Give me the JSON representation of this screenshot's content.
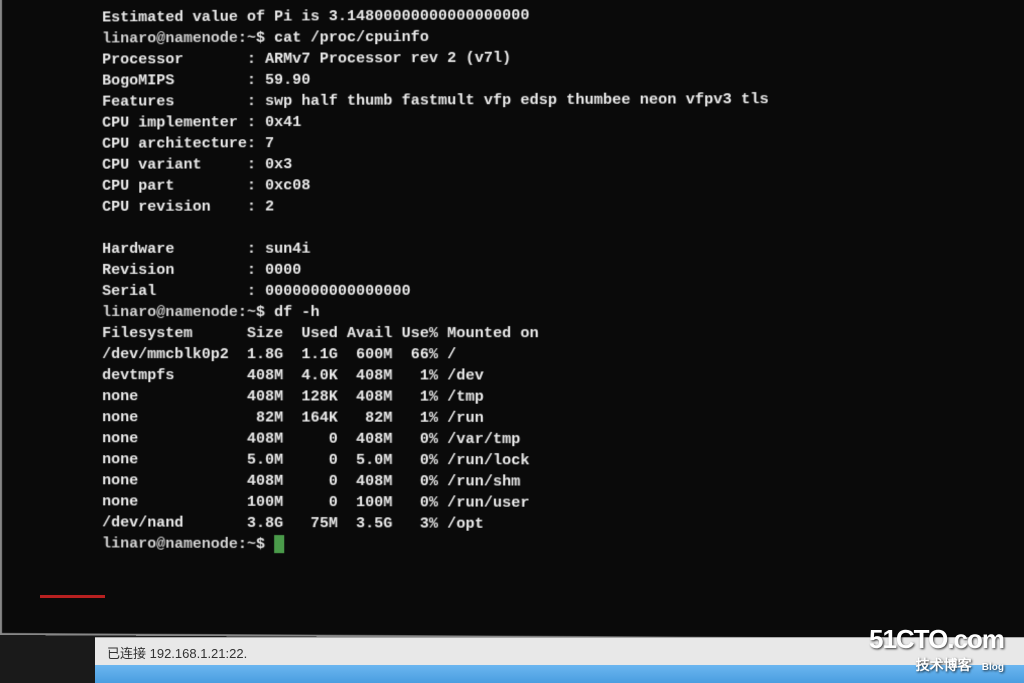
{
  "prev_output": "Estimated value of Pi is 3.14800000000000000000",
  "prompt1": {
    "userhost": "linaro@namenode",
    "path": "~",
    "cmd": "cat /proc/cpuinfo"
  },
  "cpuinfo": {
    "processor": {
      "label": "Processor",
      "value": "ARMv7 Processor rev 2 (v7l)"
    },
    "bogomips": {
      "label": "BogoMIPS",
      "value": "59.90"
    },
    "features": {
      "label": "Features",
      "value": "swp half thumb fastmult vfp edsp thumbee neon vfpv3 tls"
    },
    "cpu_implementer": {
      "label": "CPU implementer",
      "value": "0x41"
    },
    "cpu_architecture": {
      "label": "CPU architecture",
      "value": "7"
    },
    "cpu_variant": {
      "label": "CPU variant",
      "value": "0x3"
    },
    "cpu_part": {
      "label": "CPU part",
      "value": "0xc08"
    },
    "cpu_revision": {
      "label": "CPU revision",
      "value": "2"
    },
    "hardware": {
      "label": "Hardware",
      "value": "sun4i"
    },
    "revision": {
      "label": "Revision",
      "value": "0000"
    },
    "serial": {
      "label": "Serial",
      "value": "0000000000000000"
    }
  },
  "prompt2": {
    "userhost": "linaro@namenode",
    "path": "~",
    "cmd": "df -h"
  },
  "df": {
    "header": {
      "fs": "Filesystem",
      "size": "Size",
      "used": "Used",
      "avail": "Avail",
      "usepct": "Use%",
      "mount": "Mounted on"
    },
    "rows": [
      {
        "fs": "/dev/mmcblk0p2",
        "size": "1.8G",
        "used": "1.1G",
        "avail": "600M",
        "usepct": "66%",
        "mount": "/"
      },
      {
        "fs": "devtmpfs",
        "size": "408M",
        "used": "4.0K",
        "avail": "408M",
        "usepct": "1%",
        "mount": "/dev"
      },
      {
        "fs": "none",
        "size": "408M",
        "used": "128K",
        "avail": "408M",
        "usepct": "1%",
        "mount": "/tmp"
      },
      {
        "fs": "none",
        "size": "82M",
        "used": "164K",
        "avail": "82M",
        "usepct": "1%",
        "mount": "/run"
      },
      {
        "fs": "none",
        "size": "408M",
        "used": "0",
        "avail": "408M",
        "usepct": "0%",
        "mount": "/var/tmp"
      },
      {
        "fs": "none",
        "size": "5.0M",
        "used": "0",
        "avail": "5.0M",
        "usepct": "0%",
        "mount": "/run/lock"
      },
      {
        "fs": "none",
        "size": "408M",
        "used": "0",
        "avail": "408M",
        "usepct": "0%",
        "mount": "/run/shm"
      },
      {
        "fs": "none",
        "size": "100M",
        "used": "0",
        "avail": "100M",
        "usepct": "0%",
        "mount": "/run/user"
      },
      {
        "fs": "/dev/nand",
        "size": "3.8G",
        "used": "75M",
        "avail": "3.5G",
        "usepct": "3%",
        "mount": "/opt"
      }
    ]
  },
  "prompt3": {
    "userhost": "linaro@namenode",
    "path": "~",
    "cmd": ""
  },
  "statusbar": "已连接 192.168.1.21:22.",
  "watermark": {
    "brand": "51CTO.com",
    "sub": "技术博客",
    "blog": "Blog"
  }
}
